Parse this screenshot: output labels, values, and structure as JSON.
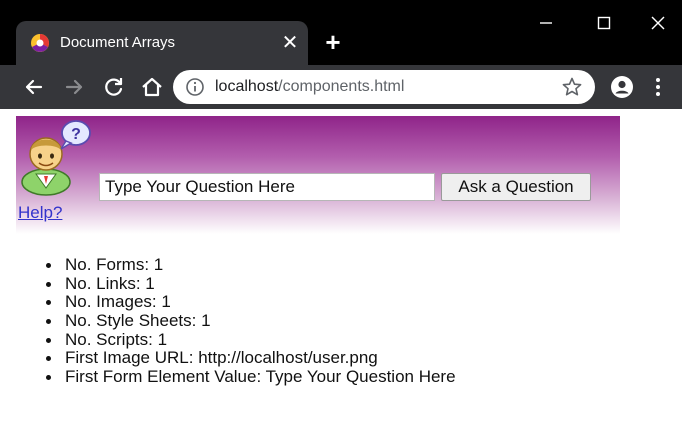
{
  "tab": {
    "title": "Document Arrays"
  },
  "address_bar": {
    "host": "localhost",
    "path": "/components.html"
  },
  "page": {
    "help_link": "Help?",
    "question_input": {
      "value": "Type Your Question Here"
    },
    "ask_button": "Ask a Question",
    "stats": [
      {
        "label": "No. Forms: 1"
      },
      {
        "label": "No. Links: 1"
      },
      {
        "label": "No. Images: 1"
      },
      {
        "label": "No. Style Sheets: 1"
      },
      {
        "label": "No. Scripts: 1"
      },
      {
        "label": "First Image URL: http://localhost/user.png"
      },
      {
        "label": "First Form Element Value: Type Your Question Here"
      }
    ]
  },
  "icons": {
    "favicon": "chrome-favicon-icon",
    "tab_close": "close-icon",
    "new_tab": "plus-icon",
    "back": "back-arrow-icon",
    "forward": "forward-arrow-icon",
    "reload": "reload-icon",
    "home": "home-icon",
    "info": "info-icon",
    "bookmark": "star-icon",
    "profile": "profile-icon",
    "menu": "kebab-menu-icon"
  },
  "colors": {
    "titlebar": "#000000",
    "toolbar": "#35363a",
    "header_gradient_top": "#8f2489",
    "link": "#3333cc"
  }
}
